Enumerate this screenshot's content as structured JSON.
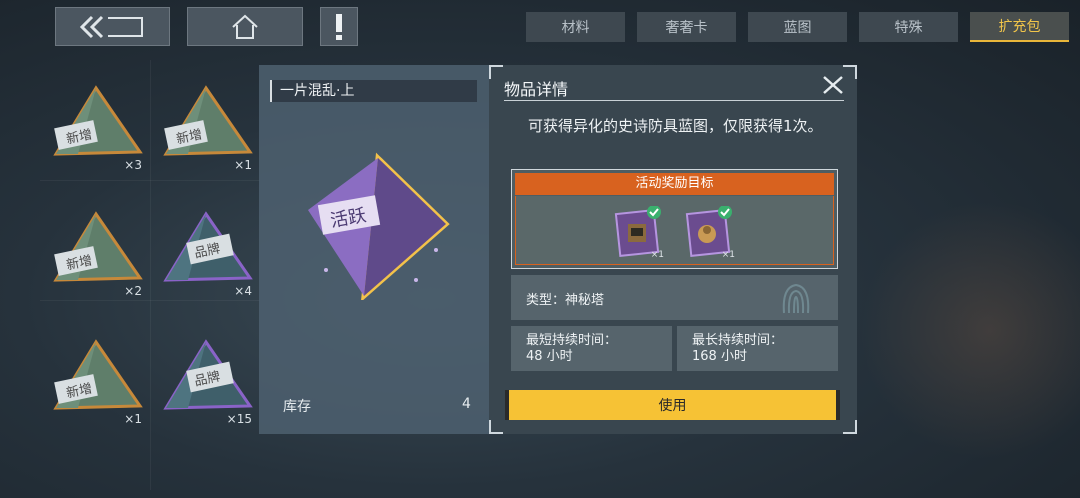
{
  "top_bar": {
    "tabs": [
      {
        "label": "材料",
        "active": false
      },
      {
        "label": "奢奢卡",
        "active": false
      },
      {
        "label": "蓝图",
        "active": false
      },
      {
        "label": "特殊",
        "active": false
      },
      {
        "label": "扩充包",
        "active": true
      }
    ],
    "icons": [
      "back-icon",
      "home-icon",
      "alert-icon"
    ]
  },
  "inventory": [
    {
      "badge": "新增",
      "count": "×3",
      "color": "#c7893a"
    },
    {
      "badge": "新增",
      "count": "×1",
      "color": "#c7893a"
    },
    {
      "badge": "新增",
      "count": "×2",
      "color": "#c7893a"
    },
    {
      "badge": "品牌",
      "count": "×4",
      "color": "#8a63c8"
    },
    {
      "badge": "新增",
      "count": "×1",
      "color": "#c7893a"
    },
    {
      "badge": "品牌",
      "count": "×15",
      "color": "#8a63c8"
    }
  ],
  "detail": {
    "name": "一片混乱·上",
    "pack_badge": "活跃",
    "stock_label": "库存",
    "stock_value": "4"
  },
  "info": {
    "title": "物品详情",
    "description": "可获得异化的史诗防具蓝图，仅限获得1次。",
    "reward_header": "活动奖励目标",
    "rewards": [
      {
        "count": "×1",
        "checked": true
      },
      {
        "count": "×1",
        "checked": true
      }
    ],
    "type_text": "类型：神秘塔",
    "min_duration_label": "最短持续时间：",
    "min_duration_value": "48 小时",
    "max_duration_label": "最长持续时间：",
    "max_duration_value": "168 小时",
    "use_button": "使用"
  },
  "colors": {
    "accent_yellow": "#f6c235",
    "reward_orange": "#d8621f",
    "active_tab": "#f1c54a"
  }
}
